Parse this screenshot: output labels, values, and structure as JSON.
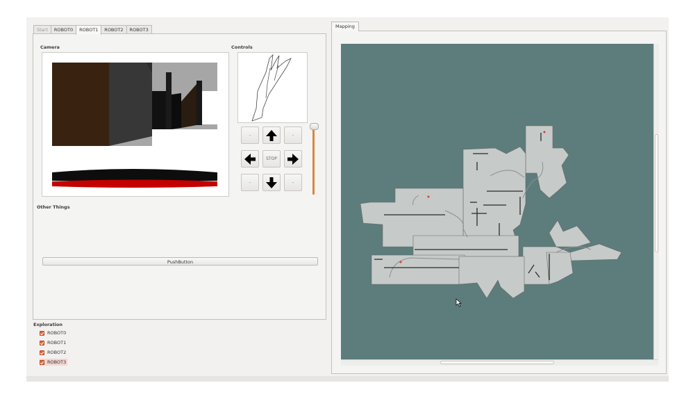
{
  "tabs": [
    "Start",
    "ROBOT0",
    "ROBOT1",
    "ROBOT2",
    "ROBOT3"
  ],
  "active_tab": "ROBOT1",
  "camera": {
    "label": "Camera"
  },
  "controls": {
    "label": "Controls",
    "side_button_label": "-",
    "stop_label": "STOP",
    "speed_level": 1.0
  },
  "other": {
    "label": "Other Things",
    "push_button": "PushButton"
  },
  "exploration": {
    "label": "Exploration",
    "robots": [
      {
        "name": "ROBOT0",
        "checked": true
      },
      {
        "name": "ROBOT1",
        "checked": true
      },
      {
        "name": "ROBOT2",
        "checked": true
      },
      {
        "name": "ROBOT3",
        "checked": true,
        "selected": true
      }
    ]
  },
  "mapping": {
    "tab_label": "Mapping"
  },
  "colors": {
    "accent": "#e0643b",
    "map_background": "#5d7c7c",
    "map_free": "#c6cac8",
    "slider": "#d9863f"
  }
}
